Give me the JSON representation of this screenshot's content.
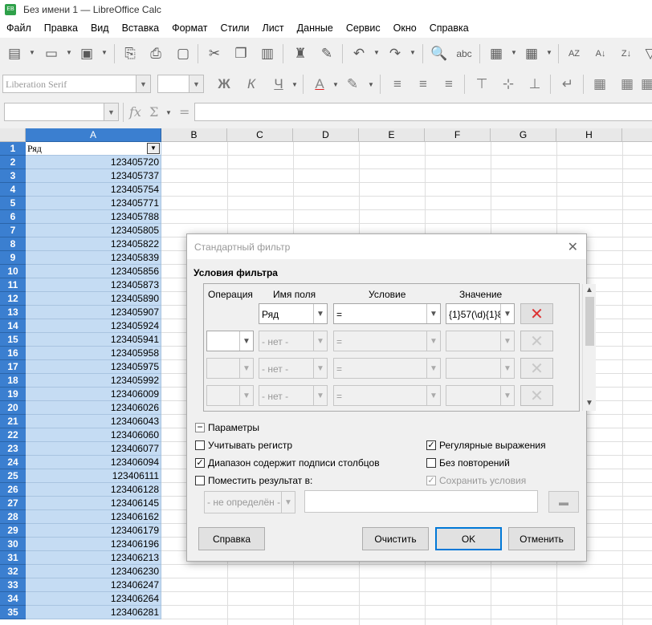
{
  "window": {
    "title": "Без имени 1 — LibreOffice Calc",
    "app_icon_text": "EB"
  },
  "menu": [
    "Файл",
    "Правка",
    "Вид",
    "Вставка",
    "Формат",
    "Стили",
    "Лист",
    "Данные",
    "Сервис",
    "Окно",
    "Справка"
  ],
  "format_toolbar": {
    "font_name": "Liberation Serif",
    "font_size": "",
    "bold": "Ж",
    "italic": "К",
    "underline": "Ч"
  },
  "formula_bar": {
    "name_box": "",
    "fx": "fx",
    "sigma": "Σ",
    "equals": "=",
    "content": ""
  },
  "columns": [
    "A",
    "B",
    "C",
    "D",
    "E",
    "F",
    "G",
    "H"
  ],
  "rows": [
    {
      "n": "1",
      "a": "Ряд"
    },
    {
      "n": "2",
      "a": "123405720"
    },
    {
      "n": "3",
      "a": "123405737"
    },
    {
      "n": "4",
      "a": "123405754"
    },
    {
      "n": "5",
      "a": "123405771"
    },
    {
      "n": "6",
      "a": "123405788"
    },
    {
      "n": "7",
      "a": "123405805"
    },
    {
      "n": "8",
      "a": "123405822"
    },
    {
      "n": "9",
      "a": "123405839"
    },
    {
      "n": "10",
      "a": "123405856"
    },
    {
      "n": "11",
      "a": "123405873"
    },
    {
      "n": "12",
      "a": "123405890"
    },
    {
      "n": "13",
      "a": "123405907"
    },
    {
      "n": "14",
      "a": "123405924"
    },
    {
      "n": "15",
      "a": "123405941"
    },
    {
      "n": "16",
      "a": "123405958"
    },
    {
      "n": "17",
      "a": "123405975"
    },
    {
      "n": "18",
      "a": "123405992"
    },
    {
      "n": "19",
      "a": "123406009"
    },
    {
      "n": "20",
      "a": "123406026"
    },
    {
      "n": "21",
      "a": "123406043"
    },
    {
      "n": "22",
      "a": "123406060"
    },
    {
      "n": "23",
      "a": "123406077"
    },
    {
      "n": "24",
      "a": "123406094"
    },
    {
      "n": "25",
      "a": "123406111"
    },
    {
      "n": "26",
      "a": "123406128"
    },
    {
      "n": "27",
      "a": "123406145"
    },
    {
      "n": "28",
      "a": "123406162"
    },
    {
      "n": "29",
      "a": "123406179"
    },
    {
      "n": "30",
      "a": "123406196"
    },
    {
      "n": "31",
      "a": "123406213"
    },
    {
      "n": "32",
      "a": "123406230"
    },
    {
      "n": "33",
      "a": "123406247"
    },
    {
      "n": "34",
      "a": "123406264"
    },
    {
      "n": "35",
      "a": "123406281"
    }
  ],
  "dialog": {
    "title": "Стандартный фильтр",
    "section_title": "Условия фильтра",
    "headers": {
      "operation": "Операция",
      "field_name": "Имя поля",
      "condition": "Условие",
      "value": "Значение"
    },
    "conditions": [
      {
        "operation": "",
        "field": "Ряд",
        "condition": "=",
        "value": "{1}57(\\d){1}8"
      },
      {
        "operation": "",
        "field": "- нет -",
        "condition": "=",
        "value": ""
      },
      {
        "operation": "",
        "field": "- нет -",
        "condition": "=",
        "value": ""
      },
      {
        "operation": "",
        "field": "- нет -",
        "condition": "=",
        "value": ""
      }
    ],
    "params_label": "Параметры",
    "params_toggle": "−",
    "options": {
      "case_sensitive": {
        "label": "Учитывать регистр",
        "checked": false
      },
      "range_has_headers": {
        "label": "Диапазон содержит подписи столбцов",
        "checked": true
      },
      "copy_results": {
        "label": "Поместить результат в:",
        "checked": false
      },
      "regex": {
        "label": "Регулярные выражения",
        "checked": true
      },
      "no_duplicates": {
        "label": "Без повторений",
        "checked": false
      },
      "keep_criteria": {
        "label": "Сохранить условия",
        "checked": true
      }
    },
    "dest_select": "- не определён -",
    "check_mark": "✓",
    "buttons": {
      "help": "Справка",
      "reset": "Очистить",
      "ok": "OK",
      "cancel": "Отменить"
    }
  }
}
